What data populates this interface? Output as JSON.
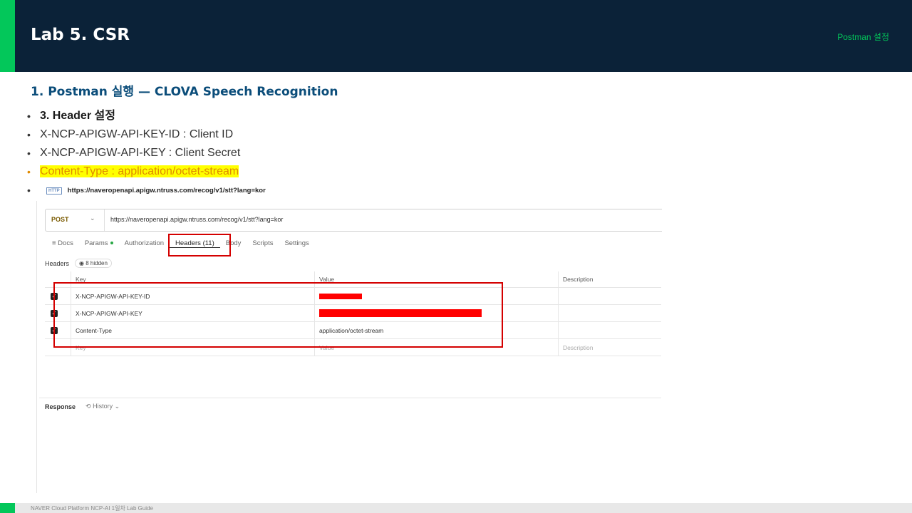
{
  "header": {
    "title": "Lab 5. CSR",
    "tag": "Postman 설정"
  },
  "section_title": "1.  Postman 실행 — CLOVA Speech Recognition",
  "bullets": [
    "3. Header 설정",
    "X-NCP-APIGW-API-KEY-ID : Client ID",
    "X-NCP-APIGW-API-KEY : Client Secret",
    "Content-Type : application/octet-stream"
  ],
  "postman": {
    "top_url": "https://naveropenapi.apigw.ntruss.com/recog/v1/stt?lang=kor",
    "http_badge": "HTTP",
    "method": "POST",
    "url": "https://naveropenapi.apigw.ntruss.com/recog/v1/stt?lang=kor",
    "tabs": [
      "≡ Docs",
      "Params",
      "Authorization",
      "Headers (11)",
      "Body",
      "Scripts",
      "Settings"
    ],
    "headers_label": "Headers",
    "hidden_label": "8 hidden",
    "columns": {
      "key": "Key",
      "value": "Value",
      "description": "Description"
    },
    "rows": [
      {
        "key": "X-NCP-APIGW-API-KEY-ID",
        "value": ""
      },
      {
        "key": "X-NCP-APIGW-API-KEY",
        "value": ""
      },
      {
        "key": "Content-Type",
        "value": "application/octet-stream"
      }
    ],
    "placeholder": {
      "key": "Key",
      "value": "Value",
      "description": "Description"
    },
    "response_label": "Response",
    "history_label": "History"
  },
  "footer": "NAVER Cloud Platform  NCP-AI 1일차 Lab Guide",
  "colors": {
    "header_bg": "#0b2238",
    "accent": "#03c75a",
    "highlight": "#ffff00",
    "redact": "#ff0000"
  }
}
